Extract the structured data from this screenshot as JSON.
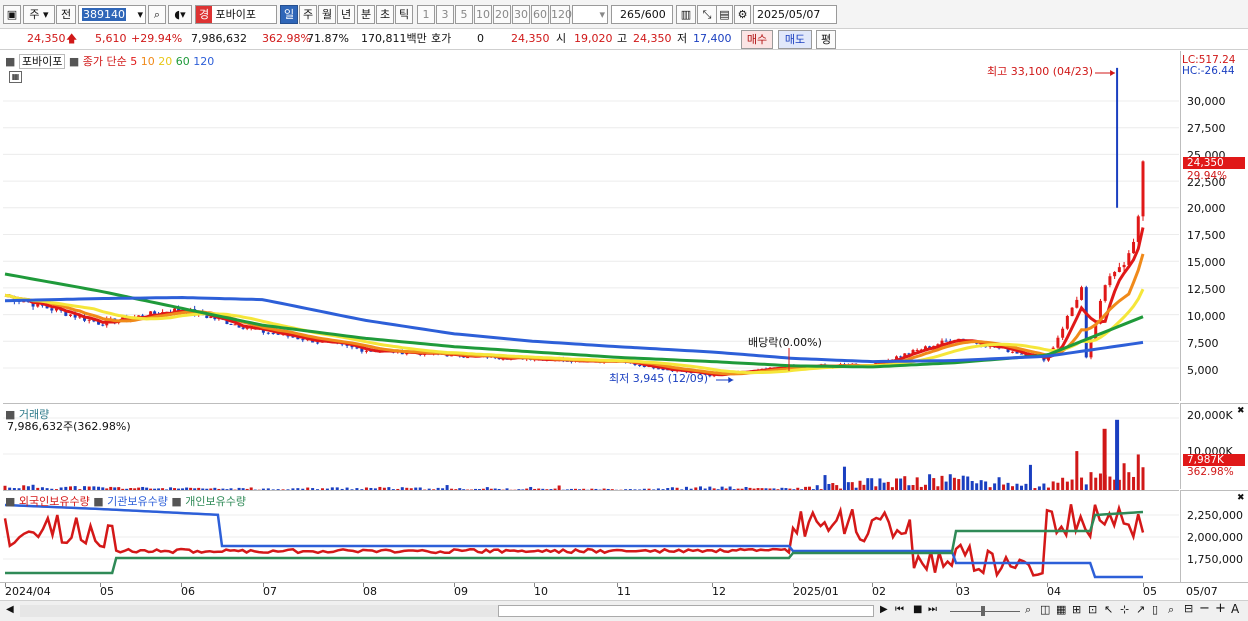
{
  "toolbar": {
    "market_type": "주",
    "prev_label": "전",
    "code": "389140",
    "stock_name": "포바이포",
    "name_badge": "경",
    "periods": [
      "일",
      "주",
      "월",
      "년",
      "분",
      "초",
      "틱"
    ],
    "active_period": "일",
    "minute_options": [
      "1",
      "3",
      "5",
      "10",
      "20",
      "30",
      "60",
      "120"
    ],
    "count": "265",
    "max_count": "/600",
    "date": "2025/05/07"
  },
  "quote": {
    "price": "24,350",
    "change": "5,610",
    "change_pct": "+29.94%",
    "volume": "7,986,632",
    "volume_ratio": "362.98%",
    "turnover": "71.87%",
    "amount": "170,811백만",
    "bid_label": "호가",
    "bid_value": "0",
    "bid_price": "24,350",
    "open_label": "시",
    "open": "19,020",
    "high_label": "고",
    "high": "24,350",
    "low_label": "저",
    "low": "17,400",
    "buy_label": "매수",
    "sell_label": "매도",
    "eval_label": "평"
  },
  "price_panel": {
    "stock": "포바이포",
    "ma_label": "종가 단순",
    "ma_periods": [
      "5",
      "10",
      "20",
      "60",
      "120"
    ],
    "ma_colors": [
      "#e01818",
      "#f08a1a",
      "#f5e63a",
      "#1f9a3a",
      "#2d5fd8"
    ],
    "lc": "LC:517.24",
    "hc": "HC:-26.44",
    "max_label": "최고 33,100 (04/23)",
    "min_label": "최저 3,945 (12/09)",
    "dividend_label": "배당락(0.00%)",
    "last_price": "24,350",
    "last_pct": "29.94%",
    "y_ticks": [
      "30,000",
      "27,500",
      "25,000",
      "22,500",
      "20,000",
      "17,500",
      "15,000",
      "12,500",
      "10,000",
      "7,500",
      "5,000"
    ]
  },
  "volume_panel": {
    "title": "거래량",
    "value": "7,986,632주(362.98%)",
    "y_ticks": [
      "20,000K",
      "10,000K"
    ],
    "last": "7,987K",
    "last_pct": "362.98%"
  },
  "holding_panel": {
    "series": [
      "외국인보유수량",
      "기관보유수량",
      "개인보유수량"
    ],
    "colors": [
      "#d41818",
      "#2d5fd8",
      "#2f8a57"
    ],
    "y_ticks": [
      "2,250,000",
      "2,000,000",
      "1,750,000"
    ]
  },
  "x_axis": [
    "2024/04",
    "05",
    "06",
    "07",
    "08",
    "09",
    "10",
    "11",
    "12",
    "2025/01",
    "02",
    "03",
    "04",
    "05"
  ],
  "x_axis_end": "05/07",
  "chart_data": {
    "type": "candlestick",
    "title": "포바이포",
    "series": [
      {
        "name": "종가 단순 5"
      },
      {
        "name": "종가 단순 10"
      },
      {
        "name": "종가 단순 20"
      },
      {
        "name": "종가 단순 60"
      },
      {
        "name": "종가 단순 120"
      }
    ],
    "x": [
      "2024/04",
      "05",
      "06",
      "07",
      "08",
      "09",
      "10",
      "11",
      "12",
      "2025/01",
      "02",
      "03",
      "04",
      "05"
    ],
    "approx_close": [
      11800,
      9200,
      10500,
      8400,
      6700,
      6200,
      5900,
      5600,
      4300,
      5100,
      5300,
      7800,
      5800,
      24350
    ],
    "ma60_approx": [
      13800,
      12200,
      10600,
      9000,
      7800,
      7000,
      6500,
      6000,
      5600,
      5200,
      5100,
      5500,
      6200,
      9800
    ],
    "ma120_approx": [
      11300,
      11500,
      11600,
      11400,
      9500,
      8200,
      7500,
      7000,
      6500,
      5900,
      5600,
      5700,
      6100,
      7400
    ],
    "volume_K_approx": [
      1200,
      800,
      500,
      400,
      700,
      400,
      300,
      300,
      800,
      400,
      2500,
      3500,
      1500,
      7987
    ],
    "max": {
      "value": 33100,
      "date": "04/23"
    },
    "min": {
      "value": 3945,
      "date": "12/09"
    },
    "ylim": [
      3000,
      35000
    ]
  }
}
